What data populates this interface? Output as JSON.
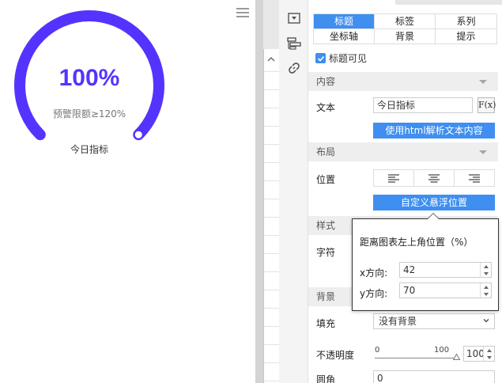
{
  "gauge": {
    "value_text": "100%",
    "subtitle": "预警限额≥120%",
    "title": "今日指标",
    "fraction": 1.0,
    "color": "#5533ff"
  },
  "colors": {
    "accent": "#3e8ff0",
    "gauge": "#5533ff",
    "section_bg": "#eeeeee"
  },
  "icons": {
    "menu": "hamburger-icon",
    "panel_toggle": "dropdown-box-icon",
    "layers": "layers-icon",
    "link": "link-icon"
  },
  "panel": {
    "tabs": [
      {
        "label": "标题",
        "active": true
      },
      {
        "label": "标签",
        "active": false
      },
      {
        "label": "系列",
        "active": false
      },
      {
        "label": "坐标轴",
        "active": false
      },
      {
        "label": "背景",
        "active": false
      },
      {
        "label": "提示",
        "active": false
      }
    ],
    "title_visible": {
      "label": "标题可见",
      "checked": true
    },
    "sections": {
      "content": "内容",
      "layout": "布局",
      "style": "样式",
      "background": "背景"
    },
    "content": {
      "text_label": "文本",
      "text_value": "今日指标",
      "fx_label": "F(x)",
      "html_button": "使用html解析文本内容"
    },
    "layout": {
      "position_label": "位置",
      "custom_button": "自定义悬浮位置"
    },
    "style": {
      "font_label": "字符"
    },
    "popover": {
      "title": "距离图表左上角位置（%）",
      "x_label": "x方向:",
      "x_value": "42",
      "y_label": "y方向:",
      "y_value": "70"
    },
    "background": {
      "fill_label": "填充",
      "fill_value": "没有背景",
      "opacity_label": "不透明度",
      "slider_min": "0",
      "slider_max": "100",
      "opacity_value": "100",
      "radius_label": "圆角",
      "radius_value": "0"
    }
  }
}
